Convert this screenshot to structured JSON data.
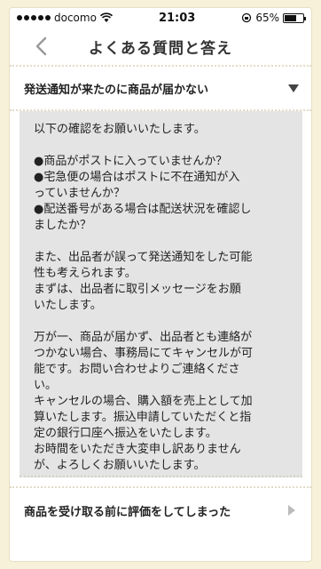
{
  "status_bar": {
    "carrier": "docomo",
    "time": "21:03",
    "battery_percent": "65%",
    "battery_level": 0.65
  },
  "nav": {
    "title": "よくある質問と答え",
    "back_icon": "chevron-left-icon"
  },
  "faq": {
    "question": "発送通知が来たのに商品が届かない",
    "expanded_icon": "triangle-down-icon",
    "answer_paragraphs": [
      [
        "以下の確認をお願いいたします。"
      ],
      [
        "●商品がポストに入っていませんか？",
        "●宅急便の場合はポストに不在通知が入",
        "っていませんか？",
        "●配送番号がある場合は配送状況を確認し",
        "ましたか？"
      ],
      [
        "また、出品者が誤って発送通知をした可能",
        "性も考えられます。",
        "まずは、出品者に取引メッセージをお願",
        "いたします。"
      ],
      [
        "万が一、商品が届かず、出品者とも連絡が",
        "つかない場合、事務局にてキャンセルが可",
        "能です。お問い合わせよりご連絡くださ",
        "い。",
        "キャンセルの場合、購入額を売上として加",
        "算いたします。振込申請していただくと指",
        "定の銀行口座へ振込をいたします。",
        "お時間をいただき大変申し訳ありません",
        "が、よろしくお願いいたします。"
      ]
    ]
  },
  "next_faq": {
    "question": "商品を受け取る前に評価をしてしまった",
    "icon": "triangle-right-icon"
  }
}
